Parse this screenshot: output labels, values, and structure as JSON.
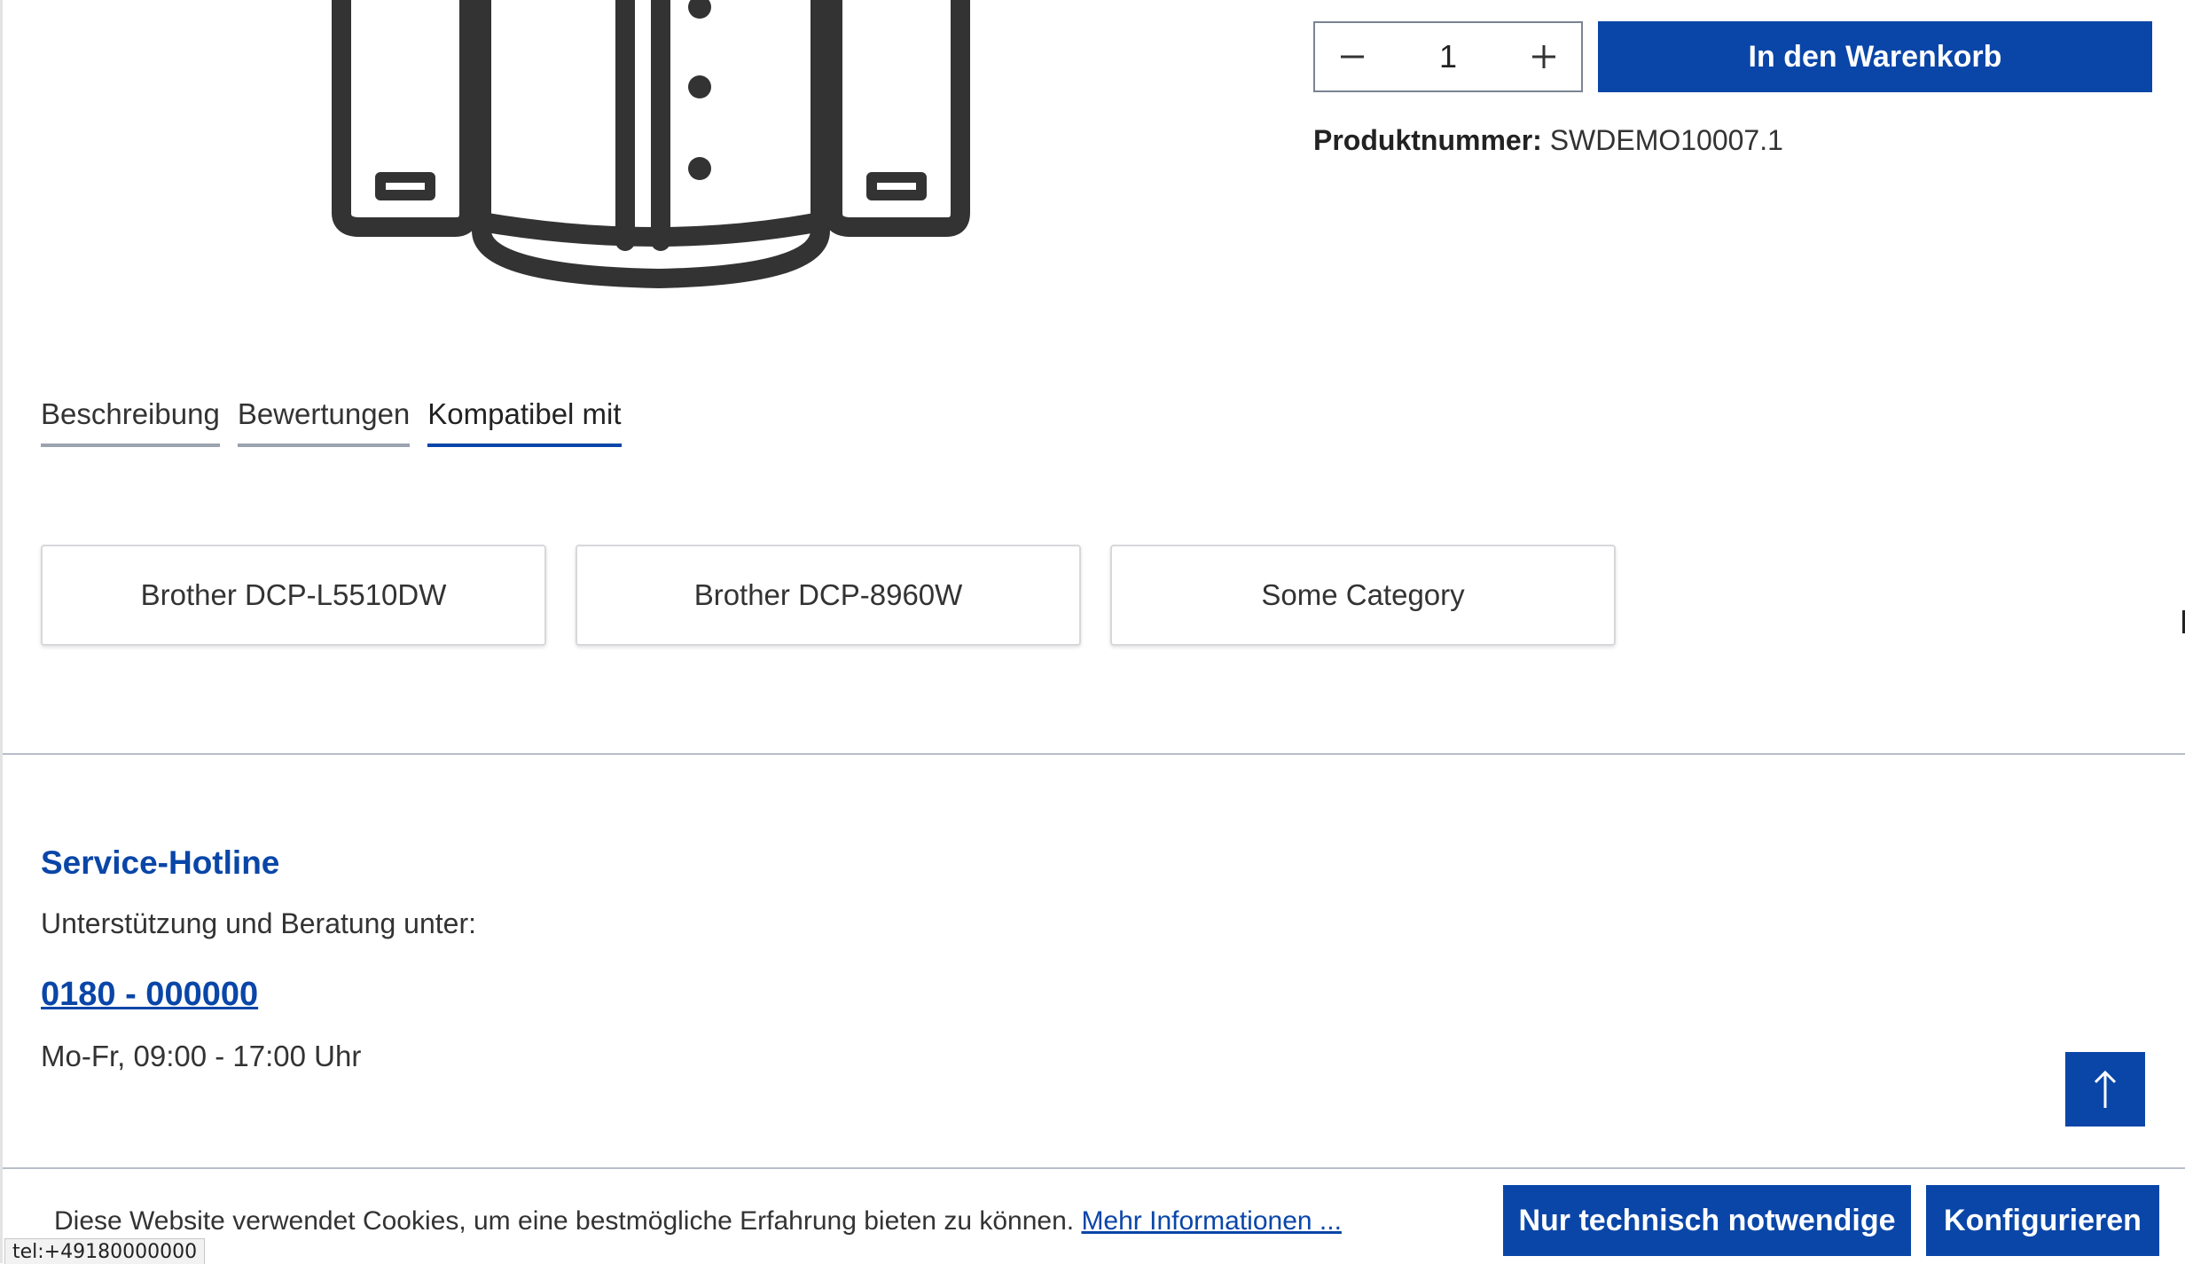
{
  "buybox": {
    "quantity": "1",
    "add_to_cart_label": "In den Warenkorb",
    "product_number_label": "Produktnummer:",
    "product_number_value": "SWDEMO10007.1"
  },
  "tabs": [
    {
      "label": "Beschreibung",
      "active": false
    },
    {
      "label": "Bewertungen",
      "active": false
    },
    {
      "label": "Kompatibel mit",
      "active": true
    }
  ],
  "compatible": [
    {
      "label": "Brother DCP-L5510DW"
    },
    {
      "label": "Brother DCP-8960W"
    },
    {
      "label": "Some Category"
    }
  ],
  "service": {
    "title": "Service-Hotline",
    "subtitle": "Unterstützung und Beratung unter:",
    "phone": "0180 - 000000",
    "hours": "Mo-Fr, 09:00 - 17:00 Uhr"
  },
  "cookie": {
    "text": "Diese Website verwendet Cookies, um eine bestmögliche Erfahrung bieten zu können.",
    "link": "Mehr Informationen ...",
    "necessary_label": "Nur technisch notwendige",
    "configure_label": "Konfigurieren"
  },
  "status_bar": {
    "url": "tel:+49180000000"
  },
  "icons": {
    "product_image": "shirt-image",
    "minus": "minus-icon",
    "plus": "plus-icon",
    "scroll_top": "arrow-up-icon"
  },
  "colors": {
    "accent": "#0a46a8",
    "text": "#222222",
    "divider": "#b7bfca"
  }
}
